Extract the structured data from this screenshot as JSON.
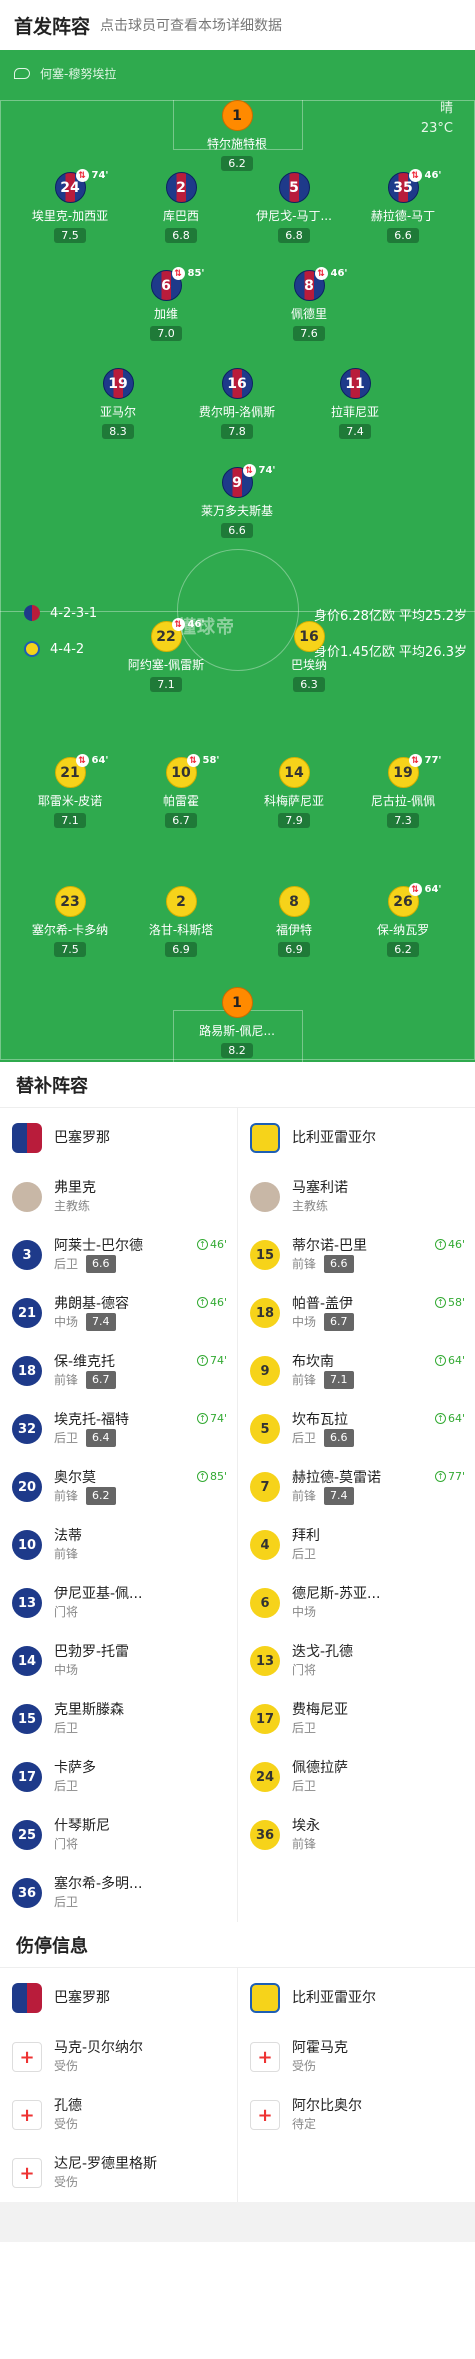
{
  "header": {
    "title": "首发阵容",
    "subtitle": "点击球员可查看本场详细数据"
  },
  "referee": "何塞-穆努埃拉",
  "weather": {
    "condition": "晴",
    "temp": "23°C"
  },
  "watermark": "懂球帝",
  "home": {
    "formation": "4-2-3-1",
    "stats": "身价6.28亿欧  平均25.2岁",
    "players": [
      {
        "no": "1",
        "name": "特尔施特根",
        "rating": "6.2"
      },
      {
        "no": "24",
        "name": "埃里克-加西亚",
        "rating": "7.5",
        "event": "74'"
      },
      {
        "no": "2",
        "name": "库巴西",
        "rating": "6.8"
      },
      {
        "no": "5",
        "name": "伊尼戈-马丁...",
        "rating": "6.8"
      },
      {
        "no": "35",
        "name": "赫拉德-马丁",
        "rating": "6.6",
        "event": "46'"
      },
      {
        "no": "6",
        "name": "加维",
        "rating": "7.0",
        "event": "85'"
      },
      {
        "no": "8",
        "name": "佩德里",
        "rating": "7.6",
        "event": "46'"
      },
      {
        "no": "19",
        "name": "亚马尔",
        "rating": "8.3"
      },
      {
        "no": "16",
        "name": "费尔明-洛佩斯",
        "rating": "7.8"
      },
      {
        "no": "11",
        "name": "拉菲尼亚",
        "rating": "7.4"
      },
      {
        "no": "9",
        "name": "莱万多夫斯基",
        "rating": "6.6",
        "event": "74'"
      }
    ]
  },
  "away": {
    "formation": "4-4-2",
    "stats": "身价1.45亿欧  平均26.3岁",
    "players": [
      {
        "no": "22",
        "name": "阿约塞-佩雷斯",
        "rating": "7.1",
        "event": "46'"
      },
      {
        "no": "16",
        "name": "巴埃纳",
        "rating": "6.3"
      },
      {
        "no": "21",
        "name": "耶雷米-皮诺",
        "rating": "7.1",
        "event": "64'"
      },
      {
        "no": "10",
        "name": "帕雷霍",
        "rating": "6.7",
        "event": "58'"
      },
      {
        "no": "14",
        "name": "科梅萨尼亚",
        "rating": "7.9"
      },
      {
        "no": "19",
        "name": "尼古拉-佩佩",
        "rating": "7.3",
        "event": "77'"
      },
      {
        "no": "23",
        "name": "塞尔希-卡多纳",
        "rating": "7.5"
      },
      {
        "no": "2",
        "name": "洛甘-科斯塔",
        "rating": "6.9"
      },
      {
        "no": "8",
        "name": "福伊特",
        "rating": "6.9"
      },
      {
        "no": "26",
        "name": "保-纳瓦罗",
        "rating": "6.2",
        "event": "64'"
      },
      {
        "no": "1",
        "name": "路易斯-佩尼...",
        "rating": "8.2"
      }
    ]
  },
  "subs": {
    "title": "替补阵容",
    "home_team": "巴塞罗那",
    "away_team": "比利亚雷亚尔",
    "home_coach": {
      "name": "弗里克",
      "role": "主教练"
    },
    "away_coach": {
      "name": "马塞利诺",
      "role": "主教练"
    },
    "home": [
      {
        "no": "3",
        "name": "阿莱士-巴尔德",
        "pos": "后卫",
        "rating": "6.6",
        "event": "46'"
      },
      {
        "no": "21",
        "name": "弗朗基-德容",
        "pos": "中场",
        "rating": "7.4",
        "event": "46'"
      },
      {
        "no": "18",
        "name": "保-维克托",
        "pos": "前锋",
        "rating": "6.7",
        "event": "74'"
      },
      {
        "no": "32",
        "name": "埃克托-福特",
        "pos": "后卫",
        "rating": "6.4",
        "event": "74'"
      },
      {
        "no": "20",
        "name": "奥尔莫",
        "pos": "前锋",
        "rating": "6.2",
        "event": "85'"
      },
      {
        "no": "10",
        "name": "法蒂",
        "pos": "前锋",
        "rating": "",
        "event": ""
      },
      {
        "no": "13",
        "name": "伊尼亚基-佩...",
        "pos": "门将",
        "rating": "",
        "event": ""
      },
      {
        "no": "14",
        "name": "巴勃罗-托雷",
        "pos": "中场",
        "rating": "",
        "event": ""
      },
      {
        "no": "15",
        "name": "克里斯滕森",
        "pos": "后卫",
        "rating": "",
        "event": ""
      },
      {
        "no": "17",
        "name": "卡萨多",
        "pos": "后卫",
        "rating": "",
        "event": ""
      },
      {
        "no": "25",
        "name": "什琴斯尼",
        "pos": "门将",
        "rating": "",
        "event": ""
      },
      {
        "no": "36",
        "name": "塞尔希-多明...",
        "pos": "后卫",
        "rating": "",
        "event": ""
      }
    ],
    "away": [
      {
        "no": "15",
        "name": "蒂尔诺-巴里",
        "pos": "前锋",
        "rating": "6.6",
        "event": "46'"
      },
      {
        "no": "18",
        "name": "帕普-盖伊",
        "pos": "中场",
        "rating": "6.7",
        "event": "58'"
      },
      {
        "no": "9",
        "name": "布坎南",
        "pos": "前锋",
        "rating": "7.1",
        "event": "64'"
      },
      {
        "no": "5",
        "name": "坎布瓦拉",
        "pos": "后卫",
        "rating": "6.6",
        "event": "64'"
      },
      {
        "no": "7",
        "name": "赫拉德-莫雷诺",
        "pos": "前锋",
        "rating": "7.4",
        "event": "77'"
      },
      {
        "no": "4",
        "name": "拜利",
        "pos": "后卫",
        "rating": "",
        "event": ""
      },
      {
        "no": "6",
        "name": "德尼斯-苏亚...",
        "pos": "中场",
        "rating": "",
        "event": ""
      },
      {
        "no": "13",
        "name": "迭戈-孔德",
        "pos": "门将",
        "rating": "",
        "event": ""
      },
      {
        "no": "17",
        "name": "费梅尼亚",
        "pos": "后卫",
        "rating": "",
        "event": ""
      },
      {
        "no": "24",
        "name": "佩德拉萨",
        "pos": "后卫",
        "rating": "",
        "event": ""
      },
      {
        "no": "36",
        "name": "埃永",
        "pos": "前锋",
        "rating": "",
        "event": ""
      }
    ]
  },
  "injuries": {
    "title": "伤停信息",
    "home": [
      {
        "name": "马克-贝尔纳尔",
        "status": "受伤"
      },
      {
        "name": "孔德",
        "status": "受伤"
      },
      {
        "name": "达尼-罗德里格斯",
        "status": "受伤"
      }
    ],
    "away": [
      {
        "name": "阿霍马克",
        "status": "受伤"
      },
      {
        "name": "阿尔比奥尔",
        "status": "待定"
      }
    ]
  }
}
